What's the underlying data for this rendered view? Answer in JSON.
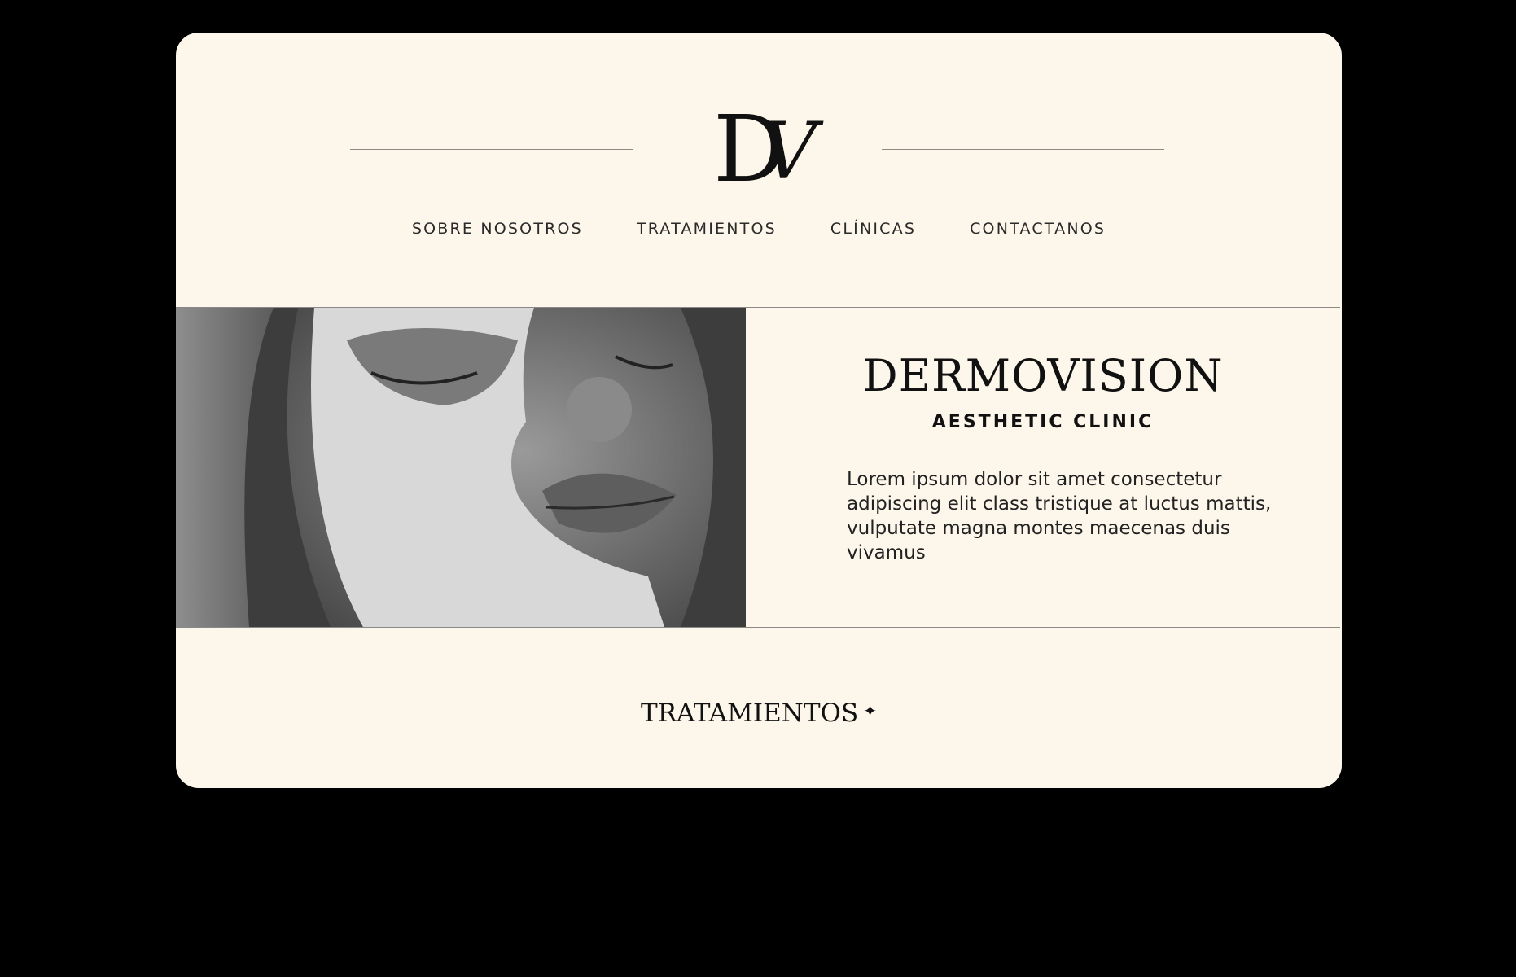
{
  "logo": {
    "d": "D",
    "v": "V"
  },
  "nav": {
    "items": [
      "SOBRE NOSOTROS",
      "TRATAMIENTOS",
      "CLÍNICAS",
      "CONTACTANOS"
    ]
  },
  "hero": {
    "title": "DERMOVISION",
    "subtitle": "AESTHETIC CLINIC",
    "body": "Lorem ipsum dolor sit amet consectetur adipiscing elit class tristique at luctus mattis, vulputate magna montes maecenas duis vivamus"
  },
  "section": {
    "title": "TRATAMIENTOS",
    "sparkle_icon": "sparkle-icon"
  },
  "colors": {
    "background": "#fdf6ea",
    "text": "#111111",
    "frame": "#000000"
  }
}
